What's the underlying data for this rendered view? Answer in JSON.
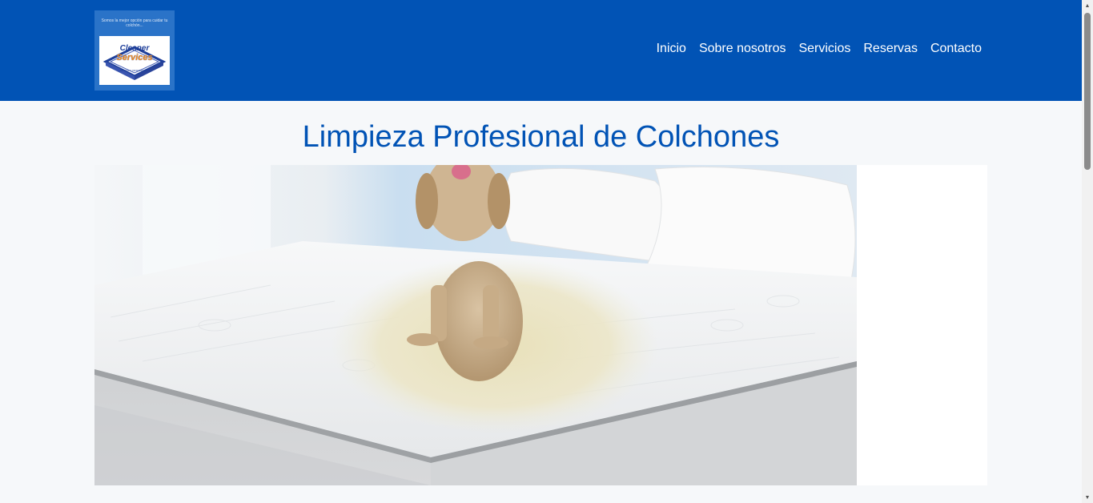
{
  "header": {
    "logo": {
      "tagline": "Somos la mejor opción para cuidar tu colchón...",
      "word1": "Cleaner",
      "word2": "Services"
    },
    "nav": [
      "Inicio",
      "Sobre nosotros",
      "Servicios",
      "Reservas",
      "Contacto"
    ]
  },
  "main": {
    "title": "Limpieza Profesional de Colchones"
  },
  "colors": {
    "header_bg": "#0153b5",
    "title": "#0153b5",
    "page_bg": "#f6f8fa"
  }
}
